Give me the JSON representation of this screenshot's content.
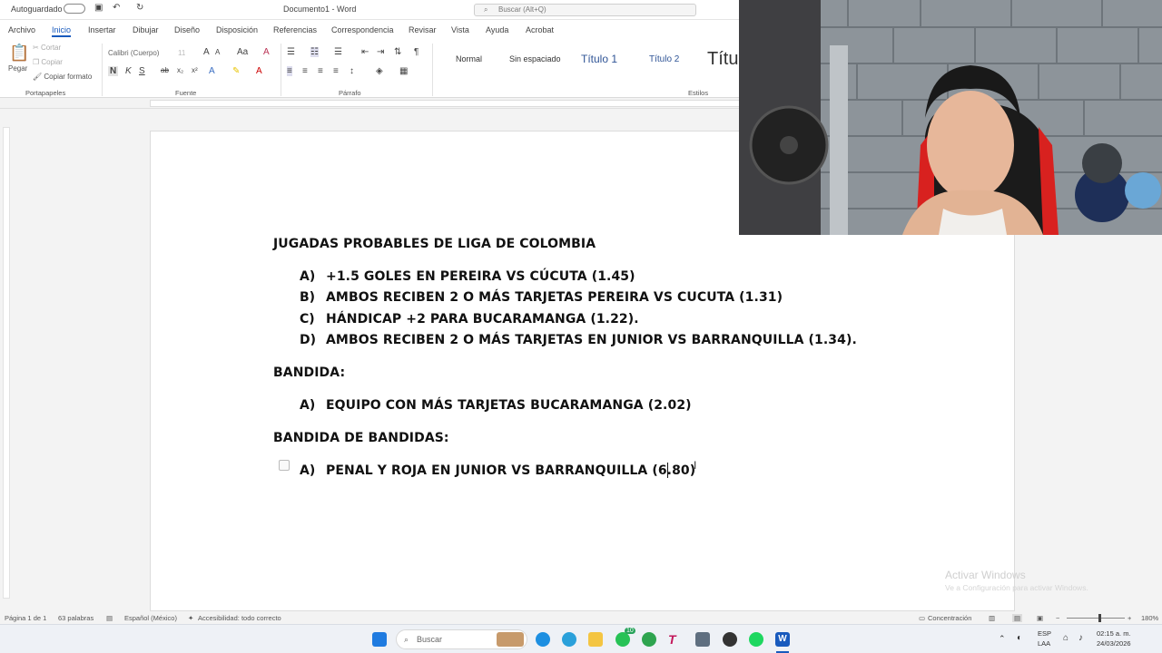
{
  "titlebar": {
    "autosave": "Autoguardado",
    "doc_title": "Documento1 - Word",
    "search_placeholder": "Buscar (Alt+Q)"
  },
  "menu": [
    "Archivo",
    "Inicio",
    "Insertar",
    "Dibujar",
    "Diseño",
    "Disposición",
    "Referencias",
    "Correspondencia",
    "Revisar",
    "Vista",
    "Ayuda",
    "Acrobat"
  ],
  "ribbon": {
    "clipboard": {
      "paste": "Pegar",
      "cut": "Cortar",
      "copy": "Copiar",
      "format_painter": "Copiar formato",
      "label": "Portapapeles"
    },
    "font": {
      "name": "Calibri (Cuerpo)",
      "size": "11",
      "label": "Fuente"
    },
    "paragraph": {
      "label": "Párrafo"
    },
    "styles": {
      "items": [
        "Normal",
        "Sin espaciado",
        "Título 1",
        "Título 2",
        "Títu"
      ],
      "label": "Estilos"
    }
  },
  "document": {
    "heading1": "JUGADAS PROBABLES DE LIGA DE COLOMBIA",
    "list1": [
      {
        "letter": "A)",
        "text": "+1.5 GOLES EN PEREIRA VS CÚCUTA (1.45)"
      },
      {
        "letter": "B)",
        "text": "AMBOS RECIBEN 2 O MÁS TARJETAS PEREIRA VS CUCUTA (1.31)"
      },
      {
        "letter": "C)",
        "text": "HÁNDICAP +2 PARA BUCARAMANGA (1.22)."
      },
      {
        "letter": "D)",
        "text": "AMBOS RECIBEN 2 O MÁS TARJETAS EN JUNIOR VS BARRANQUILLA (1.34)."
      }
    ],
    "heading2": "BANDIDA:",
    "list2": [
      {
        "letter": "A)",
        "text": "EQUIPO CON MÁS TARJETAS BUCARAMANGA (2.02)"
      }
    ],
    "heading3": "BANDIDA DE BANDIDAS:",
    "list3": [
      {
        "letter": "A)",
        "text": "PENAL Y ROJA EN JUNIOR VS BARRANQUILLA (6.80)"
      }
    ]
  },
  "statusbar": {
    "page": "Página 1 de 1",
    "words": "63 palabras",
    "language": "Español (México)",
    "accessibility": "Accesibilidad: todo correcto",
    "focus": "Concentración",
    "zoom": "180%"
  },
  "watermark": {
    "title": "Activar Windows",
    "subtitle": "Ve a Configuración para activar Windows."
  },
  "taskbar": {
    "search": "Buscar",
    "lang_top": "ESP",
    "lang_bottom": "LAA",
    "time": "02:15 a. m.",
    "date": "24/03/2026",
    "whatsapp_badge": "10"
  }
}
